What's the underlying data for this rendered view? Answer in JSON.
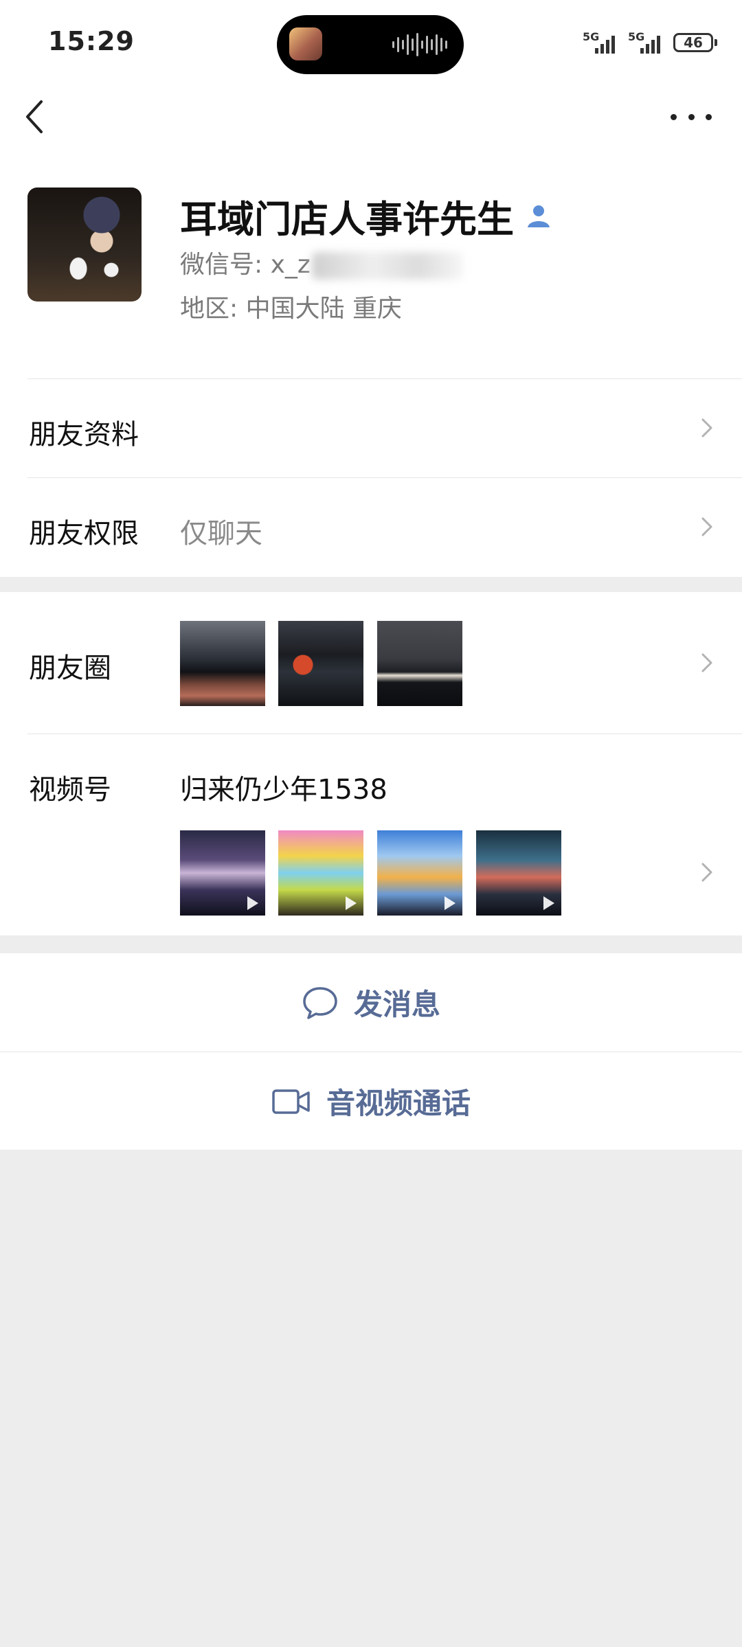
{
  "status_bar": {
    "time": "15:29",
    "network_1": "5G",
    "network_2": "5G",
    "battery": "46"
  },
  "profile": {
    "name": "耳域门店人事许先生",
    "wechat_label": "微信号:",
    "wechat_id_visible": "x_z",
    "region_label": "地区:",
    "region_value": "中国大陆  重庆"
  },
  "rows": {
    "friend_info_label": "朋友资料",
    "friend_permission_label": "朋友权限",
    "friend_permission_value": "仅聊天",
    "moments_label": "朋友圈",
    "channels_label": "视频号",
    "channels_name": "归来仍少年1538"
  },
  "actions": {
    "send_message": "发消息",
    "av_call": "音视频通话"
  },
  "colors": {
    "link_blue": "#576b95",
    "background": "#ededed",
    "badge_blue": "#5b8ed6"
  },
  "icons": [
    "back-icon",
    "more-icon",
    "verified-person-icon",
    "chevron-right-icon",
    "chat-bubble-icon",
    "video-camera-icon",
    "play-icon"
  ]
}
